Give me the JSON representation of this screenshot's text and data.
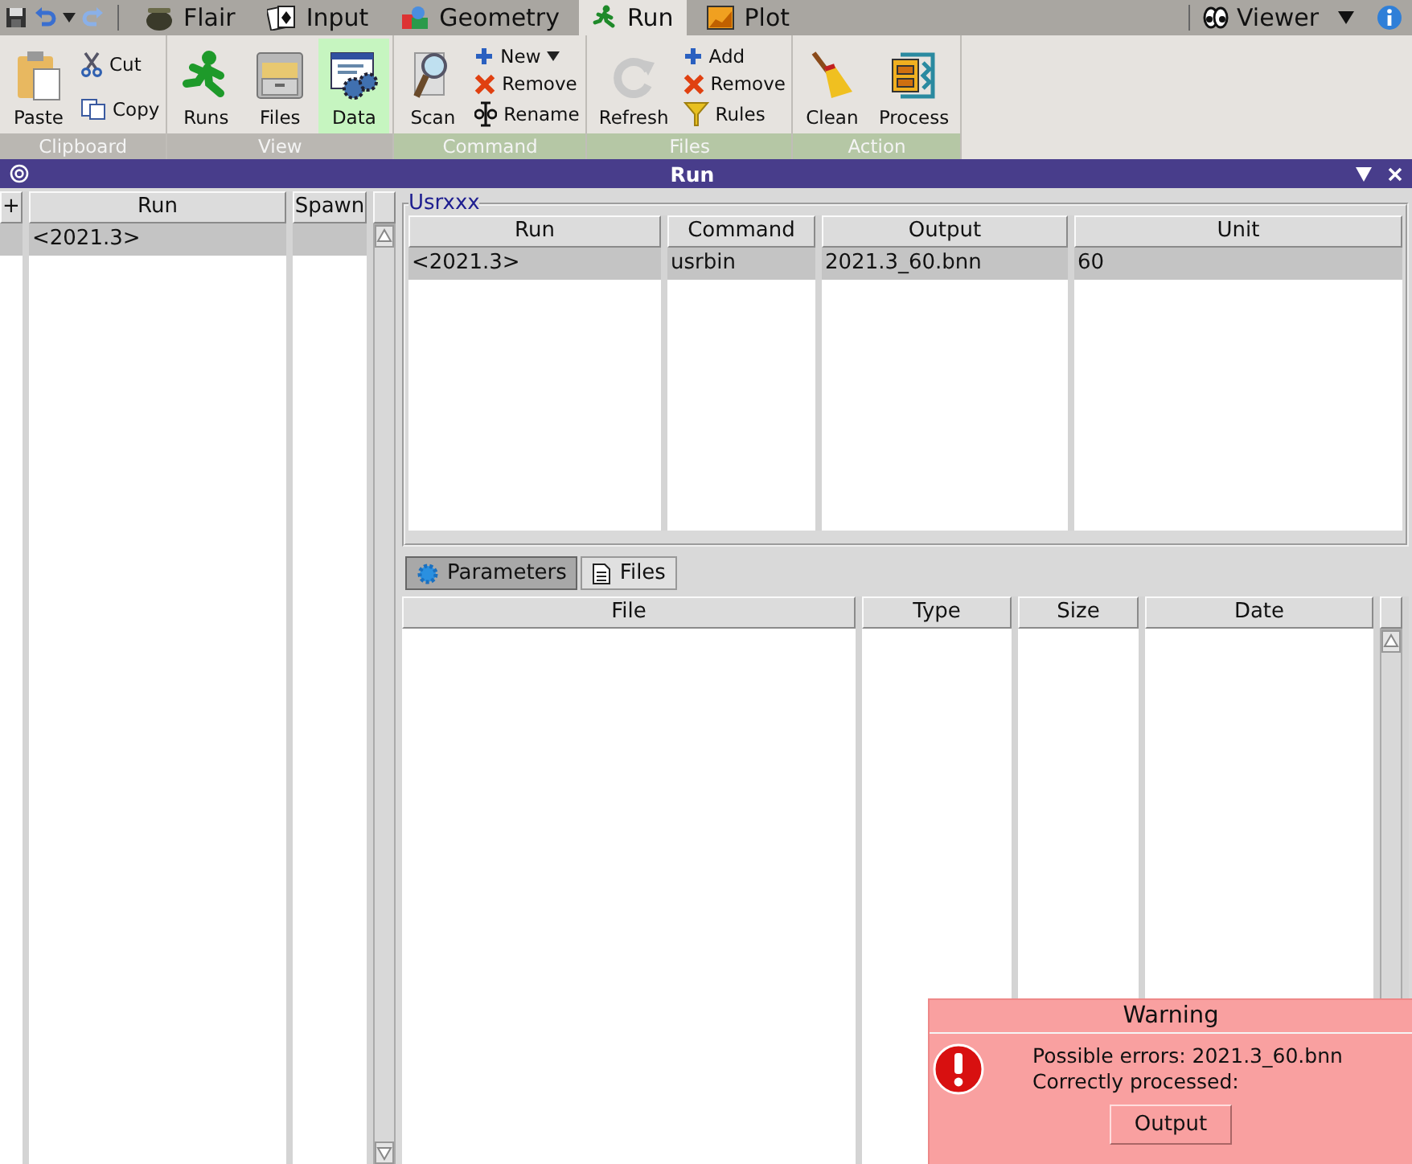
{
  "tabs": [
    {
      "label": "Flair",
      "selected": false
    },
    {
      "label": "Input",
      "selected": false
    },
    {
      "label": "Geometry",
      "selected": false
    },
    {
      "label": "Run",
      "selected": true
    },
    {
      "label": "Plot",
      "selected": false
    }
  ],
  "viewer": {
    "label": "Viewer"
  },
  "ribbon": {
    "groups": [
      {
        "label": "Clipboard",
        "kind": "general",
        "items": [
          {
            "label": "Paste",
            "kind": "large",
            "selected": false
          },
          {
            "label": "Cut",
            "kind": "small"
          },
          {
            "label": "Copy",
            "kind": "small"
          }
        ]
      },
      {
        "label": "View",
        "kind": "general",
        "items": [
          {
            "label": "Runs",
            "kind": "large",
            "selected": false
          },
          {
            "label": "Files",
            "kind": "large",
            "selected": false
          },
          {
            "label": "Data",
            "kind": "large",
            "selected": true
          }
        ]
      },
      {
        "label": "Command",
        "kind": "contextual",
        "items": [
          {
            "label": "Scan",
            "kind": "large",
            "selected": false
          },
          {
            "label": "New",
            "kind": "small",
            "dropdown": true
          },
          {
            "label": "Remove",
            "kind": "small"
          },
          {
            "label": "Rename",
            "kind": "small"
          }
        ]
      },
      {
        "label": "Files",
        "kind": "contextual",
        "items": [
          {
            "label": "Refresh",
            "kind": "large",
            "selected": false
          },
          {
            "label": "Add",
            "kind": "small"
          },
          {
            "label": "Remove",
            "kind": "small"
          },
          {
            "label": "Rules",
            "kind": "small"
          }
        ]
      },
      {
        "label": "Action",
        "kind": "contextual",
        "items": [
          {
            "label": "Clean",
            "kind": "large",
            "selected": false
          },
          {
            "label": "Process",
            "kind": "large",
            "selected": false
          }
        ]
      }
    ]
  },
  "panel": {
    "title": "Run"
  },
  "runs_table": {
    "columns": [
      "+",
      "Run",
      "Spawn"
    ],
    "rows": [
      {
        "run": "<2021.3>",
        "selected": true
      }
    ]
  },
  "usrxxx": {
    "title": "Usrxxx",
    "columns": [
      "Run",
      "Command",
      "Output",
      "Unit"
    ],
    "rows": [
      {
        "cells": [
          "<2021.3>",
          "usrbin",
          "2021.3_60.bnn",
          "60"
        ],
        "selected": true
      }
    ]
  },
  "lower_tabs": [
    {
      "label": "Parameters",
      "selected": true
    },
    {
      "label": "Files",
      "selected": false
    }
  ],
  "files_table": {
    "columns": [
      "File",
      "Type",
      "Size",
      "Date"
    ]
  },
  "warning": {
    "title": "Warning",
    "lines": [
      "Possible errors: 2021.3_60.bnn",
      "Correctly processed:"
    ],
    "button": "Output"
  }
}
